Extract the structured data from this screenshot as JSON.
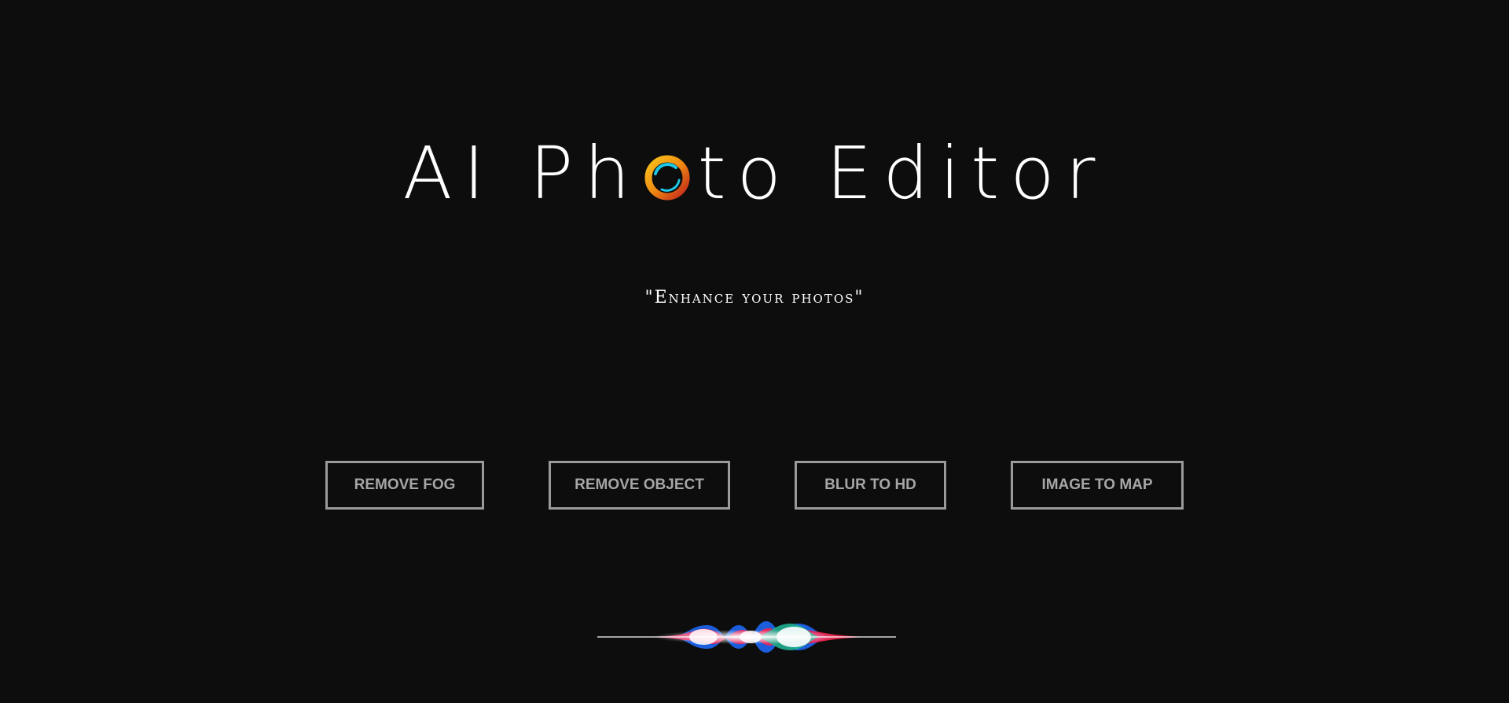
{
  "hero": {
    "title_part1": "AI Ph",
    "title_part2": "to Editor",
    "logo_icon": "camera-lens-ring-icon",
    "subtitle": "\"Enhance your photos\""
  },
  "buttons": [
    {
      "label": "REMOVE FOG"
    },
    {
      "label": "REMOVE OBJECT"
    },
    {
      "label": "BLUR TO HD"
    },
    {
      "label": "IMAGE TO MAP"
    }
  ],
  "decor": {
    "wave_icon": "voice-waveform-icon",
    "colors": {
      "background": "#0d0d0d",
      "button_border": "#9a9a9a",
      "button_text": "#a6a6a6",
      "ring_orange": "#f39c12",
      "ring_cyan": "#1ec8e6",
      "wave_red": "#ff1f4b",
      "wave_blue": "#1e6cff",
      "wave_green": "#1fae8f"
    }
  }
}
